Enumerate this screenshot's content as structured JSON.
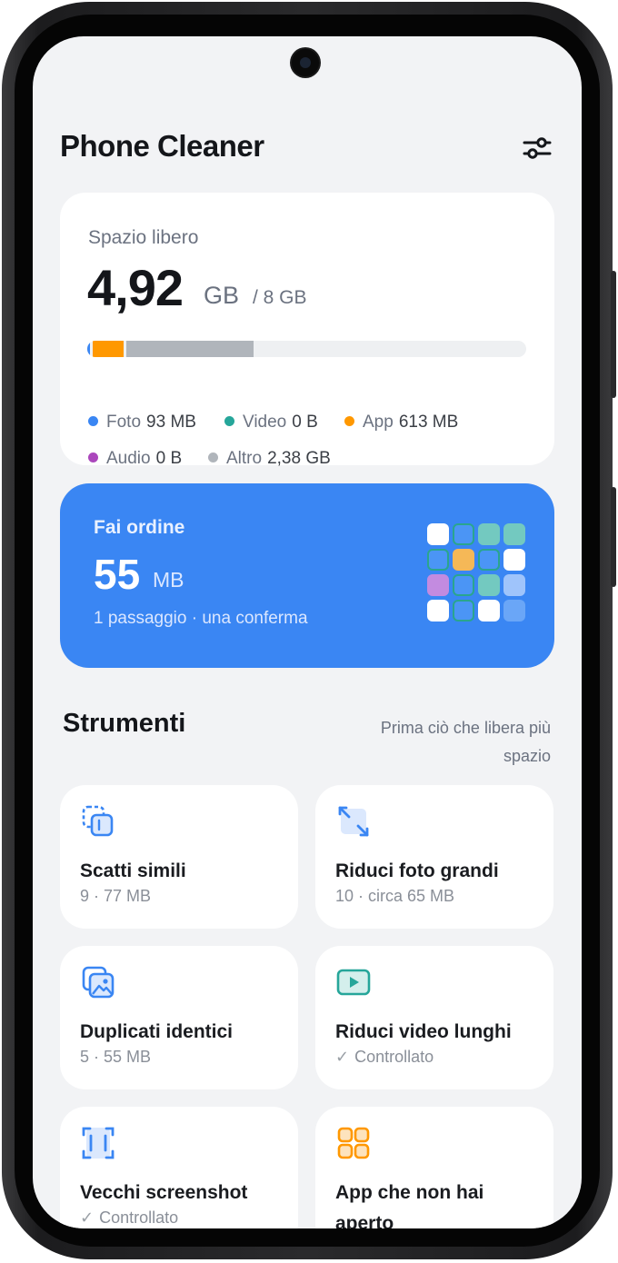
{
  "app": {
    "title": "Phone Cleaner"
  },
  "storage": {
    "label": "Spazio libero",
    "free_value": "4,92",
    "free_unit": "GB",
    "total": "/ 8 GB",
    "used_fraction": {
      "foto": 0.012,
      "app": 0.077,
      "altro": 0.297
    },
    "legend": [
      {
        "name": "Foto",
        "value": "93 MB",
        "color": "#3a86f3"
      },
      {
        "name": "Video",
        "value": "0 B",
        "color": "#26a69a"
      },
      {
        "name": "App",
        "value": "613 MB",
        "color": "#ff9800"
      },
      {
        "name": "Audio",
        "value": "0 B",
        "color": "#ab47bc"
      },
      {
        "name": "Altro",
        "value": "2,38 GB",
        "color": "#b0b5bb"
      }
    ]
  },
  "hero": {
    "title": "Fai ordine",
    "value": "55",
    "unit": "MB",
    "subtitle": "1 passaggio · una conferma"
  },
  "tools_section": {
    "title": "Strumenti",
    "hint": "Prima ciò che libera più spazio",
    "items": [
      {
        "name": "Scatti simili",
        "meta": "9 · 77 MB",
        "icon": "similar-photos-icon",
        "color": "#3a86f3"
      },
      {
        "name": "Riduci foto grandi",
        "meta": "10 · circa 65 MB",
        "icon": "resize-icon",
        "color": "#3a86f3"
      },
      {
        "name": "Duplicati identici",
        "meta": "5 · 55 MB",
        "icon": "duplicates-icon",
        "color": "#3a86f3"
      },
      {
        "name": "Riduci video lunghi",
        "meta": "Controllato",
        "icon": "video-icon",
        "color": "#26a69a"
      },
      {
        "name": "Vecchi screenshot",
        "meta": "Controllato",
        "icon": "screenshot-icon",
        "color": "#3a86f3"
      },
      {
        "name": "App che non hai aperto",
        "meta": "",
        "icon": "apps-grid-icon",
        "color": "#ff9800"
      }
    ]
  }
}
